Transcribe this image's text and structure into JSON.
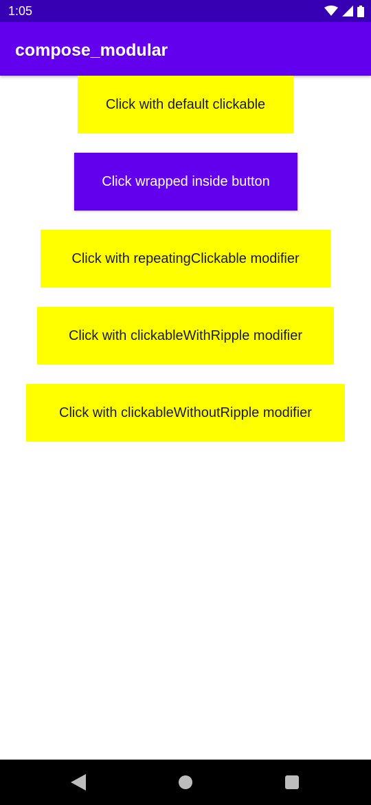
{
  "status_bar": {
    "time": "1:05",
    "icons": [
      "wifi-icon",
      "signal-icon",
      "battery-icon"
    ]
  },
  "app_bar": {
    "title": "compose_modular"
  },
  "buttons": [
    {
      "label": "Click with default clickable",
      "style": "yellow"
    },
    {
      "label": "Click wrapped inside button",
      "style": "purple"
    },
    {
      "label": "Click with repeatingClickable modifier",
      "style": "yellow"
    },
    {
      "label": "Click with clickableWithRipple modifier",
      "style": "yellow"
    },
    {
      "label": "Click with clickableWithoutRipple modifier",
      "style": "yellow"
    }
  ],
  "nav_bar": {
    "icons": [
      "back-icon",
      "home-icon",
      "recents-icon"
    ]
  },
  "colors": {
    "status_bar": "#3700B3",
    "app_bar": "#6200EE",
    "yellow_button": "#FFFF00",
    "nav_bar": "#000000"
  }
}
